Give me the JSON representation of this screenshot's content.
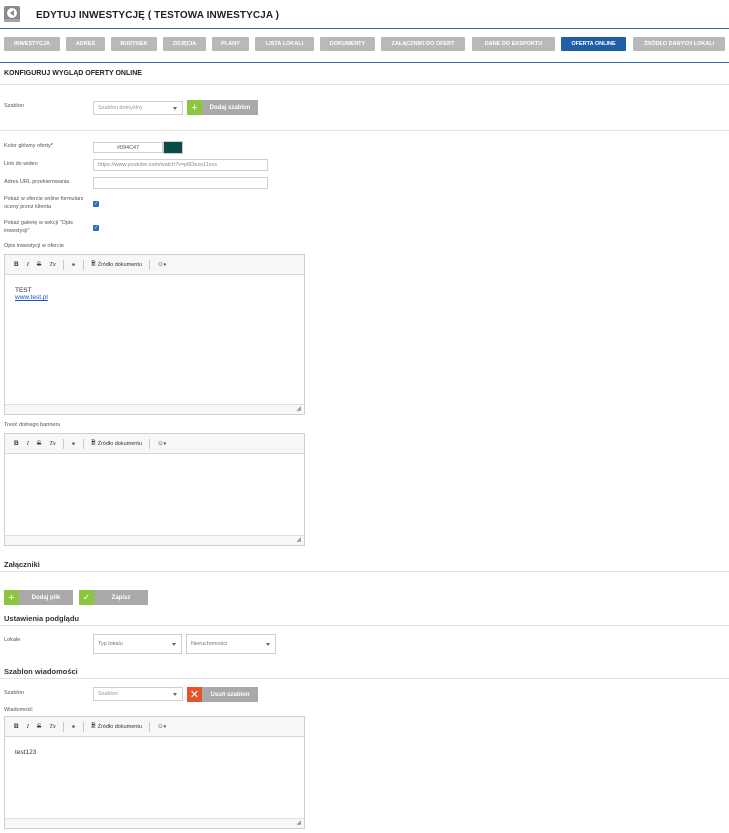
{
  "header": {
    "logo_icon": "back-arrow-icon",
    "title": "EDYTUJ INWESTYCJĘ ( TESTOWA INWESTYCJA )"
  },
  "tabs": [
    {
      "label": "INWESTYCJA",
      "active": false
    },
    {
      "label": "ADRES",
      "active": false
    },
    {
      "label": "BUDYNEK",
      "active": false
    },
    {
      "label": "ZDJĘCIA",
      "active": false
    },
    {
      "label": "PLANY",
      "active": false
    },
    {
      "label": "LISTA LOKALI",
      "active": false
    },
    {
      "label": "DOKUMENTY",
      "active": false
    },
    {
      "label": "ZAŁĄCZNIKI DO OFERT",
      "active": false
    },
    {
      "label": "DANE DO EKSPORTU",
      "active": false
    },
    {
      "label": "OFERTA ONLINE",
      "active": true
    },
    {
      "label": "ŹRÓDŁO DANYCH LOKALI",
      "active": false
    }
  ],
  "config": {
    "section_title": "KONFIGURUJ WYGLĄD OFERTY ONLINE",
    "template_label": "Szablon",
    "template_value": "Szablon domyślny",
    "add_template_button": "Dodaj szablon",
    "color_label": "Kolor główny oferty",
    "required_mark": "*",
    "color_value": "#094C47",
    "video_label": "Link do wideo",
    "video_value": "https://www.youtube.com/watch?v=p6Dezo11xcs",
    "redirect_label": "Adres URL przekierowania",
    "redirect_value": "",
    "show_form_label": "Pokaż w ofercie online formularz oceny przez klienta",
    "show_form_checked": true,
    "show_gallery_label": "Pokaż galerię w sekcji \"Opis inwestycji\"",
    "show_gallery_checked": true,
    "description_label": "Opis inwestycji w ofercie",
    "banner_label": "Treść dolnego banneru"
  },
  "editor": {
    "bold": "B",
    "italic": "I",
    "strike": "S",
    "clear_format": "Tx",
    "source_label": "Źródło dokumentu",
    "emoji": "☺",
    "emoji_caret": "▾"
  },
  "description_content": {
    "line1": "TEST",
    "link": "www.test.pl"
  },
  "attachments": {
    "title": "Załączniki",
    "add_file_button": "Dodaj plik",
    "save_button": "Zapisz"
  },
  "preview": {
    "title": "Ustawienia podglądu",
    "premises_label": "Lokale",
    "premises_type_placeholder": "Typ lokalu",
    "property_placeholder": "Nieruchomości"
  },
  "message_template": {
    "title": "Szablon wiadomości",
    "template_label": "Szablon",
    "template_placeholder": "Szablon",
    "remove_button": "Usuń szablon",
    "message_label": "Wiadomość",
    "message_content": "test123"
  },
  "colors": {
    "accent_blue": "#1f5fa8",
    "tab_gray": "#b9b9b9",
    "green": "#8cc63e",
    "red": "#e4542a",
    "swatch": "#094C47"
  }
}
